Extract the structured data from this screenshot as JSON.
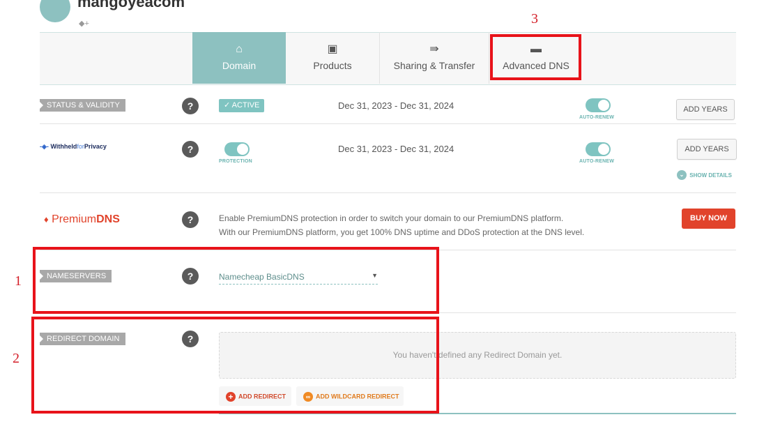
{
  "header": {
    "domain_name": "mangoyeacom",
    "tag_icon": "tag-add-icon"
  },
  "tabs": [
    {
      "label": "Domain",
      "icon": "home-icon",
      "active": true
    },
    {
      "label": "Products",
      "icon": "box-icon",
      "active": false
    },
    {
      "label": "Sharing & Transfer",
      "icon": "transfer-icon",
      "active": false
    },
    {
      "label": "Advanced DNS",
      "icon": "server-icon",
      "active": false
    }
  ],
  "status": {
    "label": "STATUS & VALIDITY",
    "badge": "✓ ACTIVE",
    "dates": "Dec 31, 2023 - Dec 31, 2024",
    "auto_renew": "AUTO-RENEW",
    "add_years": "ADD YEARS"
  },
  "privacy": {
    "logo_withheld": "Withheld",
    "logo_for": "for",
    "logo_privacy": "Privacy",
    "protection": "PROTECTION",
    "dates": "Dec 31, 2023 - Dec 31, 2024",
    "auto_renew": "AUTO-RENEW",
    "add_years": "ADD YEARS",
    "show_details": "SHOW DETAILS"
  },
  "premium_dns": {
    "logo_premium": "Premium",
    "logo_dns": "DNS",
    "line1": "Enable PremiumDNS protection in order to switch your domain to our PremiumDNS platform.",
    "line2": "With our PremiumDNS platform, you get 100% DNS uptime and DDoS protection at the DNS level.",
    "buy_now": "BUY NOW"
  },
  "nameservers": {
    "label": "NAMESERVERS",
    "selected": "Namecheap BasicDNS"
  },
  "redirect": {
    "label": "REDIRECT DOMAIN",
    "empty_text": "You haven't defined any Redirect Domain yet.",
    "add_redirect": "ADD REDIRECT",
    "add_wildcard": "ADD WILDCARD REDIRECT"
  },
  "annotations": {
    "one": "1",
    "two": "2",
    "three": "3"
  },
  "colors": {
    "teal": "#8dc1c0",
    "toggle": "#7fc4c1",
    "buy_now": "#e1432b",
    "annotation_red": "#e8131a"
  }
}
